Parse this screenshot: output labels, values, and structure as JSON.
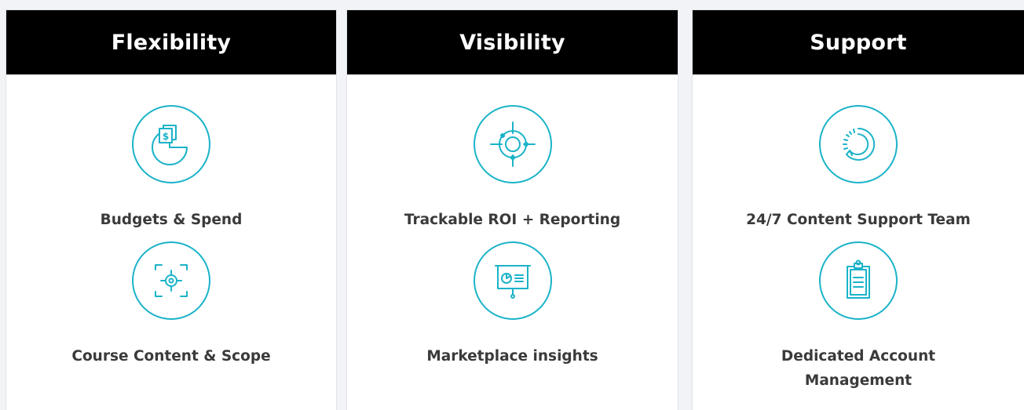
{
  "accent_color": "#1bb3c8",
  "cards": [
    {
      "title": "Flexibility",
      "features": [
        {
          "label": "Budgets & Spend",
          "icon": "budget-pie-icon"
        },
        {
          "label": "Course Content & Scope",
          "icon": "scope-target-icon"
        }
      ]
    },
    {
      "title": "Visibility",
      "features": [
        {
          "label": "Trackable ROI + Reporting",
          "icon": "crosshair-icon"
        },
        {
          "label": "Marketplace insights",
          "icon": "presentation-board-icon"
        }
      ]
    },
    {
      "title": "Support",
      "features": [
        {
          "label": "24/7 Content Support Team",
          "icon": "refresh-support-icon"
        },
        {
          "label": "Dedicated Account Management",
          "icon": "clipboard-icon"
        }
      ]
    }
  ]
}
